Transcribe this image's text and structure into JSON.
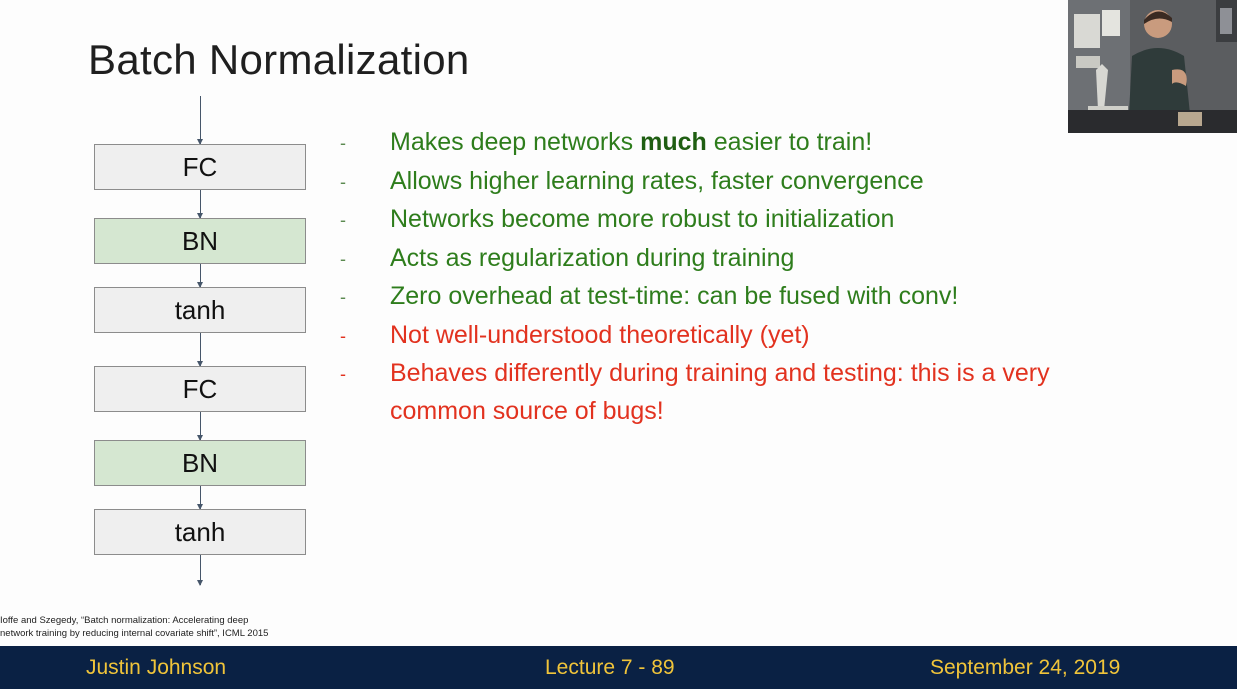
{
  "slide": {
    "title": "Batch Normalization"
  },
  "diagram": {
    "layers": [
      {
        "label": "FC",
        "kind": "fc"
      },
      {
        "label": "BN",
        "kind": "bn"
      },
      {
        "label": "tanh",
        "kind": "tanh"
      },
      {
        "label": "FC",
        "kind": "fc"
      },
      {
        "label": "BN",
        "kind": "bn"
      },
      {
        "label": "tanh",
        "kind": "tanh"
      }
    ],
    "colors": {
      "fc_fill": "#efefef",
      "bn_fill": "#d5e7d1",
      "arrow": "#46566a"
    }
  },
  "bullets": {
    "dash": "-",
    "items": [
      {
        "prefix": "Makes deep networks ",
        "bold": "much",
        "suffix": " easier to train!",
        "tone": "pro"
      },
      {
        "prefix": "Allows higher learning rates, faster convergence",
        "bold": "",
        "suffix": "",
        "tone": "pro"
      },
      {
        "prefix": "Networks become more robust to initialization",
        "bold": "",
        "suffix": "",
        "tone": "pro"
      },
      {
        "prefix": "Acts as regularization during training",
        "bold": "",
        "suffix": "",
        "tone": "pro"
      },
      {
        "prefix": "Zero overhead at test-time: can be fused with conv!",
        "bold": "",
        "suffix": "",
        "tone": "pro"
      },
      {
        "prefix": "Not well-understood theoretically (yet)",
        "bold": "",
        "suffix": "",
        "tone": "con"
      },
      {
        "prefix": "Behaves differently during training and testing: this is a very common source of bugs!",
        "bold": "",
        "suffix": "",
        "tone": "con"
      }
    ],
    "colors": {
      "pro": "#2e7d1c",
      "con": "#e2321f"
    }
  },
  "citation": {
    "line1": "Ioffe and Szegedy, “Batch normalization: Accelerating deep",
    "line2": "network training by reducing internal covariate shift”, ICML 2015"
  },
  "footer": {
    "author": "Justin Johnson",
    "lecture": "Lecture 7 - 89",
    "date": "September 24, 2019",
    "colors": {
      "background": "#0a2144",
      "text": "#f0c43a"
    }
  }
}
